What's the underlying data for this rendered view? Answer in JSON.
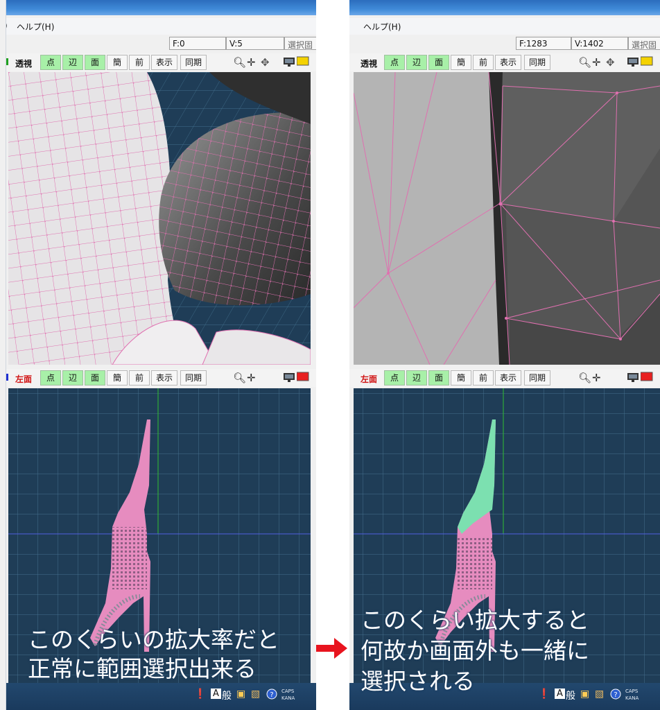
{
  "left": {
    "menu": {
      "partial": ")",
      "help": "ヘルプ(H)"
    },
    "status": {
      "faces": "F:0",
      "verts": "V:5",
      "select": "選択固"
    },
    "top_toolbar": {
      "view": "透視",
      "point": "点",
      "edge": "辺",
      "face": "面",
      "simple": "簡",
      "front": "前",
      "display": "表示",
      "sync": "同期"
    },
    "bottom_toolbar": {
      "view": "左面",
      "point": "点",
      "edge": "辺",
      "face": "面",
      "simple": "簡",
      "front": "前",
      "display": "表示",
      "sync": "同期"
    },
    "caption_line1": "このくらいの拡大率だと",
    "caption_line2": "正常に範囲選択出来る"
  },
  "right": {
    "menu": {
      "help": "ヘルプ(H)"
    },
    "status": {
      "faces": "F:1283",
      "verts": "V:1402",
      "select": "選択固"
    },
    "top_toolbar": {
      "view": "透視",
      "point": "点",
      "edge": "辺",
      "face": "面",
      "simple": "簡",
      "front": "前",
      "display": "表示",
      "sync": "同期"
    },
    "bottom_toolbar": {
      "view": "左面",
      "point": "点",
      "edge": "辺",
      "face": "面",
      "simple": "簡",
      "front": "前",
      "display": "表示",
      "sync": "同期"
    },
    "caption_line1": "このくらい拡大すると",
    "caption_line2": "何故か画面外も一緒に",
    "caption_line3": "選択される"
  },
  "taskbar": {
    "ime_a": "A",
    "ime_mode": "般",
    "caps": "CAPS",
    "kana": "KANA"
  },
  "colors": {
    "selected_toggle": "#a8f0a8",
    "viewport_bg": "#1f3d57",
    "wire": "#e070b0",
    "selected_mesh": "#7ce0b0",
    "arrow": "#e8141e"
  },
  "icons": [
    "zoom-icon",
    "move-icon",
    "rotate-icon",
    "monitor-icon",
    "color-swatch-icon",
    "warning-icon",
    "help-icon",
    "arrow-right-icon"
  ]
}
